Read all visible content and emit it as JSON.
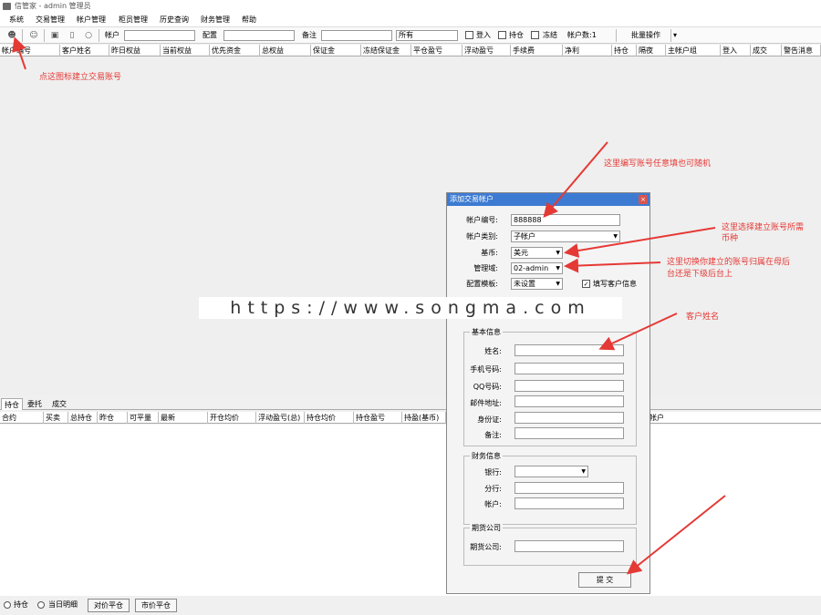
{
  "window": {
    "title": "信管家 - admin 管理员"
  },
  "menu": [
    "系统",
    "交易管理",
    "帐户管理",
    "柜员管理",
    "历史查询",
    "财务管理",
    "帮助"
  ],
  "toolbar": {
    "account_label": "帐户",
    "config_label": "配置",
    "note_label": "备注",
    "filter_value": "所有",
    "login_label": "登入",
    "holding_label": "持仓",
    "frozen_label": "冻结",
    "account_count": "帐户数:1",
    "batch_label": "批量操作"
  },
  "main_columns": [
    "帐户编号",
    "客户姓名",
    "昨日权益",
    "当前权益",
    "优先资金",
    "总权益",
    "保证金",
    "冻结保证金",
    "平仓盈亏",
    "浮动盈亏",
    "手续费",
    "净利",
    "持仓",
    "隔夜",
    "主帐户组",
    "登入",
    "成交",
    "警告消息"
  ],
  "bottom_tabs": [
    "持仓",
    "委托",
    "成交"
  ],
  "position_columns": [
    "合约",
    "买卖",
    "总持仓",
    "昨仓",
    "可平量",
    "最新",
    "开仓均价",
    "浮动盈亏(总)",
    "持仓均价",
    "持仓盈亏",
    "持盈(基币)",
    "帐户"
  ],
  "bottom_bar": {
    "radio_holding": "持仓",
    "radio_today": "当日明细",
    "btn_opposite_close": "对价平仓",
    "btn_market_close": "市价平仓"
  },
  "dialog": {
    "title": "添加交易帐户",
    "close": "×",
    "account_no_label": "帐户编号:",
    "account_no_value": "888888",
    "account_type_label": "帐户类别:",
    "account_type_value": "子帐户",
    "base_currency_label": "基币:",
    "base_currency_value": "美元",
    "domain_label": "管理域:",
    "domain_value": "02-admin",
    "template_label": "配置模板:",
    "template_value": "未设置",
    "fill_info_label": "填写客户信息",
    "basic_group": "基本信息",
    "name_label": "姓名:",
    "phone_label": "手机号码:",
    "qq_label": "QQ号码:",
    "email_label": "邮件地址:",
    "id_label": "身份证:",
    "note_label": "备注:",
    "finance_group": "财务信息",
    "bank_label": "银行:",
    "branch_label": "分行:",
    "account_label": "帐户:",
    "futures_group": "期货公司",
    "futures_label": "期货公司:",
    "submit": "提 交"
  },
  "annotations": {
    "create_icon": "点这图标建立交易账号",
    "account_hint": "这里编写账号任意填也可随机",
    "currency_hint_1": "这里选择建立账号所需",
    "currency_hint_2": "币种",
    "domain_hint_1": "这里切换你建立的账号归属在母后",
    "domain_hint_2": "台还是下级后台上",
    "name_hint": "客户姓名"
  },
  "watermark": "https://www.songma.com",
  "colors": {
    "annotation_red": "#e53935",
    "dialog_title_blue": "#3d7bd2"
  }
}
